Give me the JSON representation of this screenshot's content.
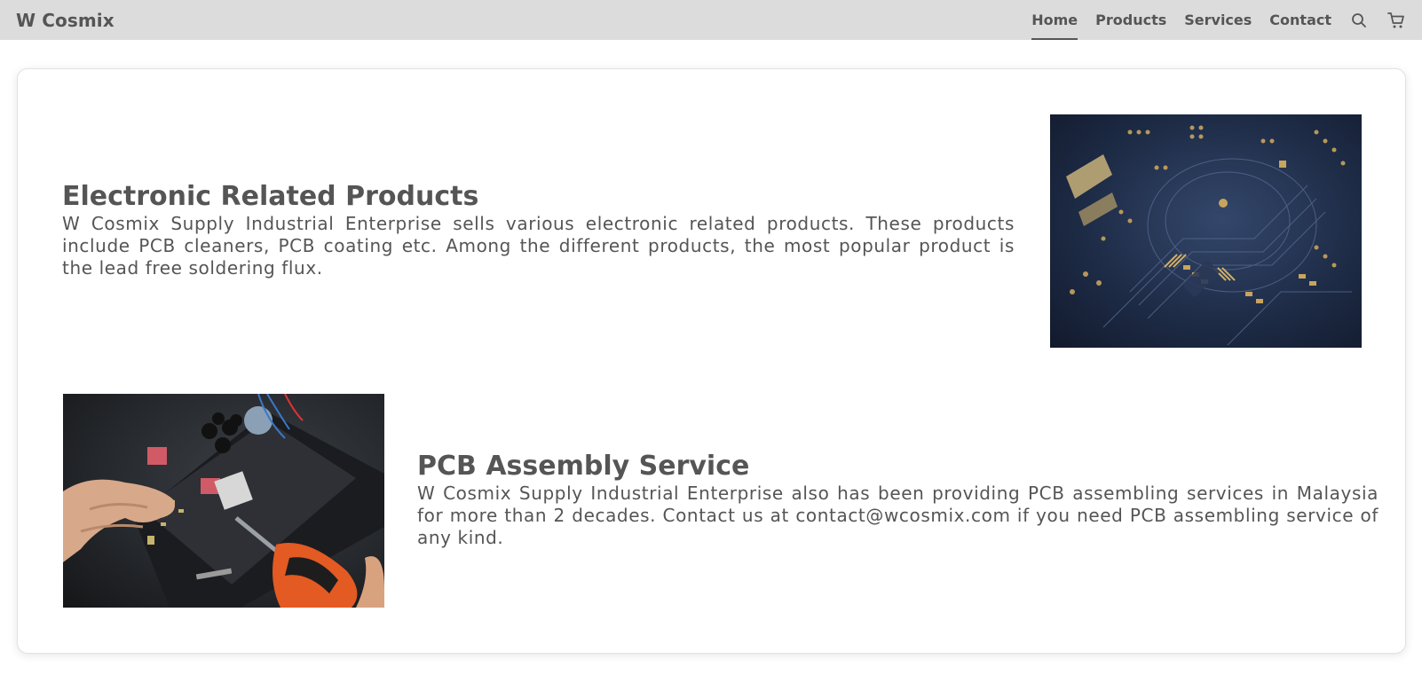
{
  "header": {
    "brand": "W Cosmix",
    "nav": [
      {
        "label": "Home",
        "active": true
      },
      {
        "label": "Products",
        "active": false
      },
      {
        "label": "Services",
        "active": false
      },
      {
        "label": "Contact",
        "active": false
      }
    ],
    "icons": [
      "search-icon",
      "cart-icon"
    ]
  },
  "sections": [
    {
      "title": "Electronic Related Products",
      "text": "W Cosmix Supply Industrial Enterprise sells various electronic related products. These products include PCB cleaners, PCB coating etc. Among the different products, the most popular product is the lead free soldering flux.",
      "image": "pcb-board-photo"
    },
    {
      "title": "PCB Assembly Service",
      "text": "W Cosmix Supply Industrial Enterprise also has been providing PCB assembling services in Malaysia for more than 2 decades. Contact us at contact@wcosmix.com if you need PCB assembling service of any kind.",
      "image": "pcb-assembly-photo"
    }
  ],
  "colors": {
    "header_bg": "#dcdcdc",
    "text": "#555555",
    "card_border": "#e2e2e2"
  }
}
